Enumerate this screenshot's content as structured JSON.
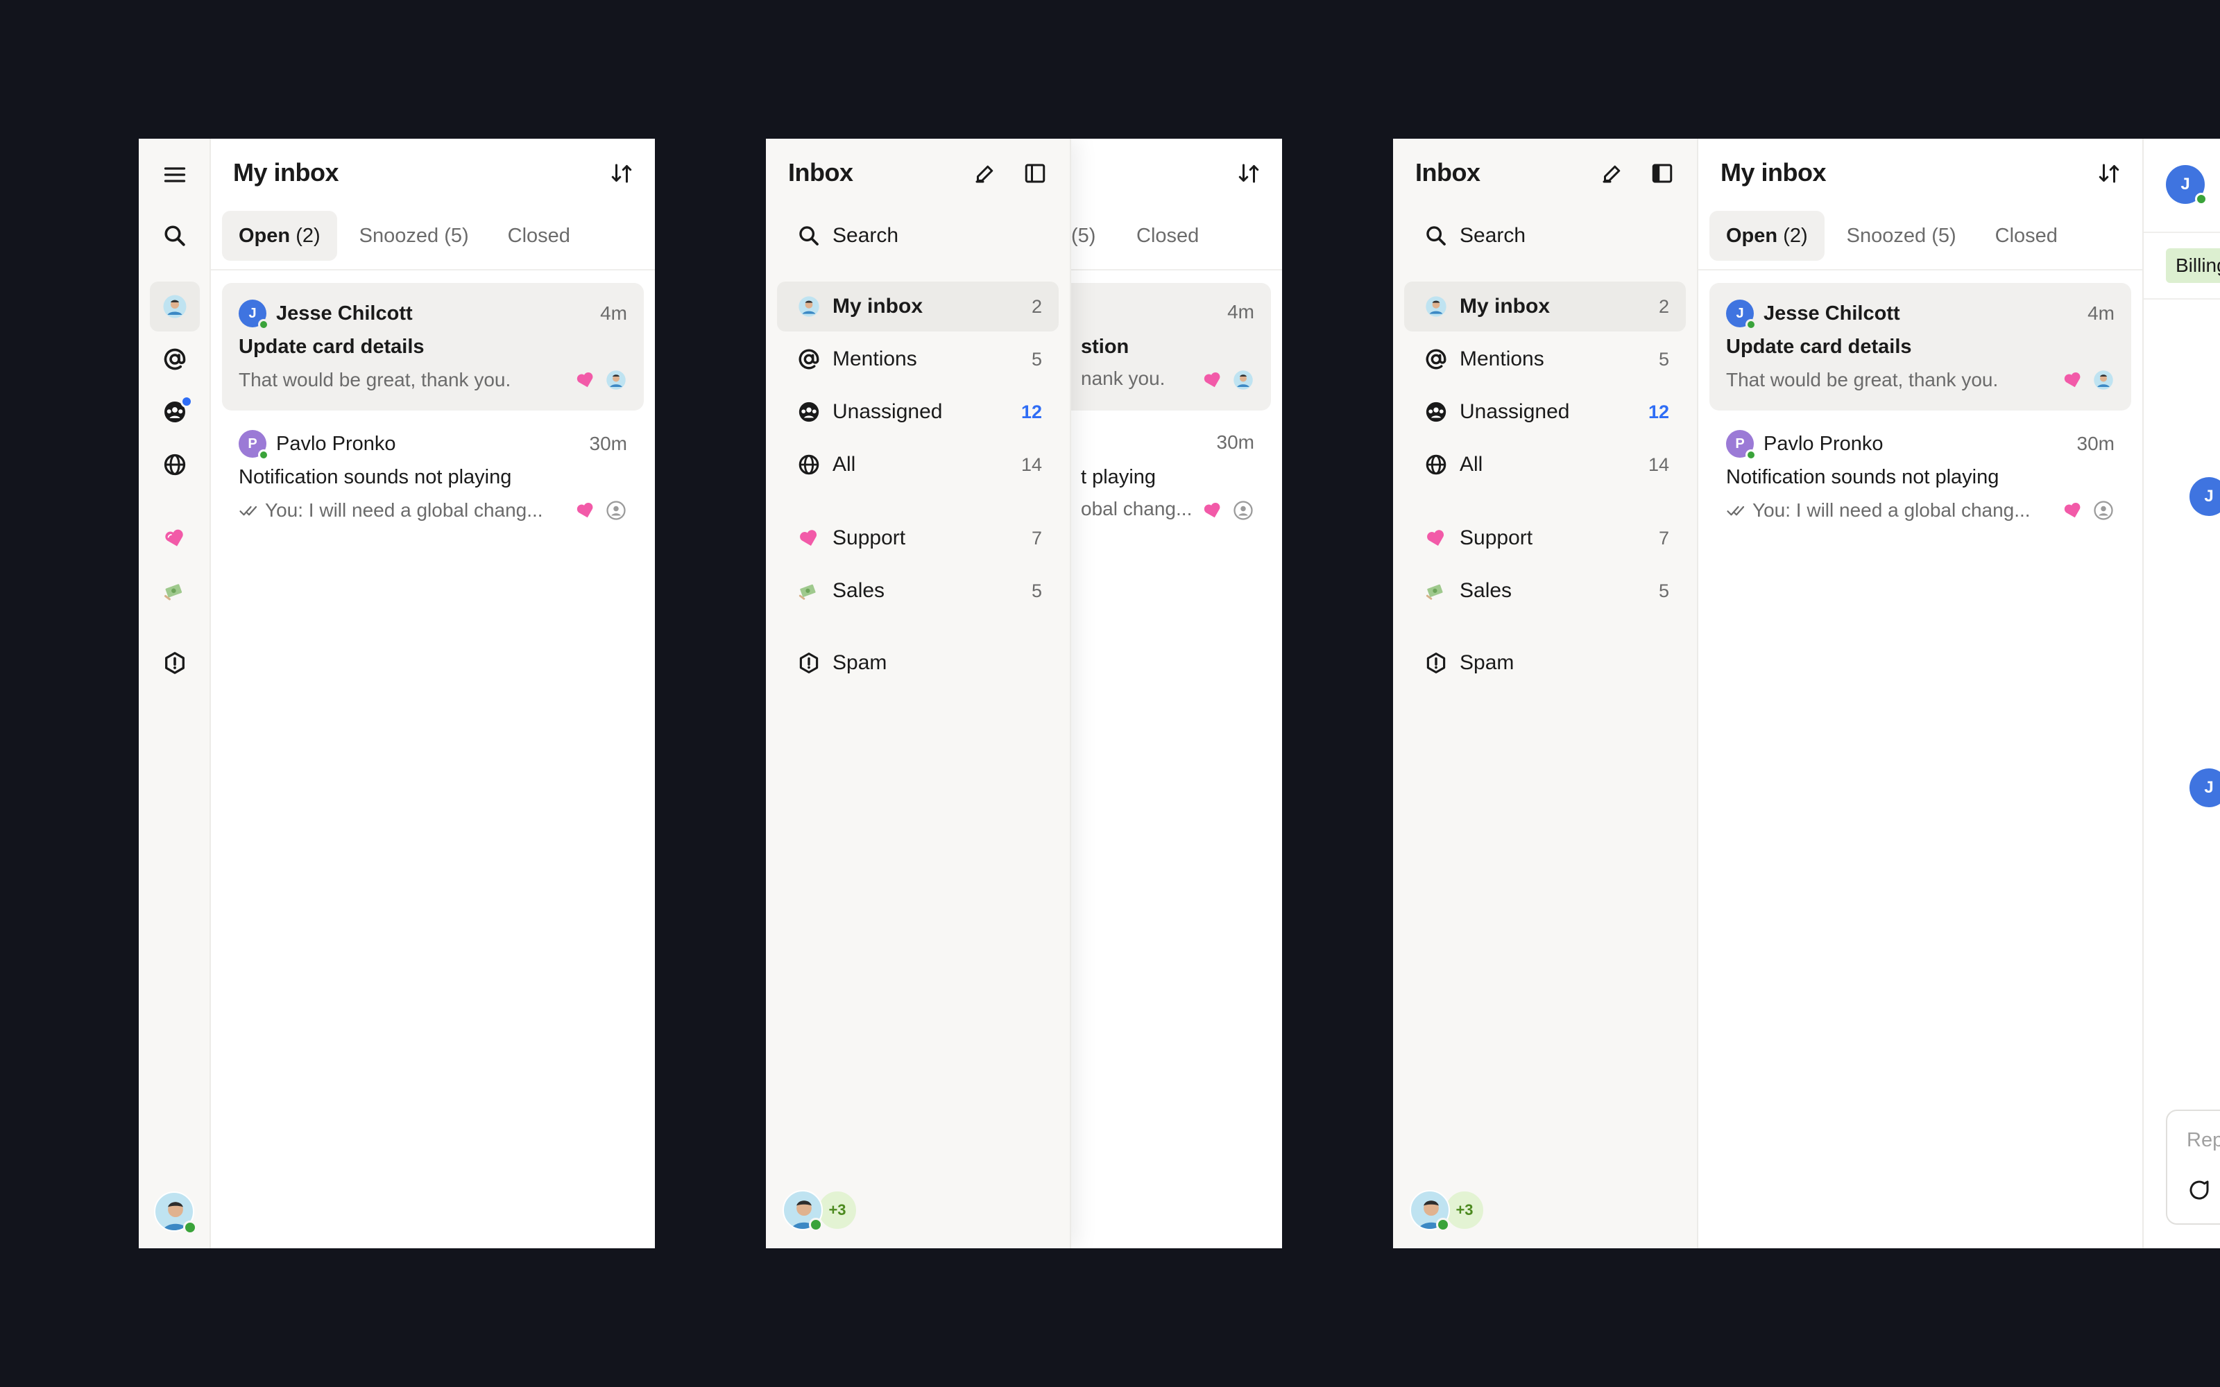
{
  "list": {
    "title": "My inbox",
    "tabs": [
      {
        "name": "Open",
        "count": "(2)"
      },
      {
        "name": "Snoozed",
        "count": "(5)"
      },
      {
        "name": "Closed",
        "count": ""
      }
    ],
    "conversations": [
      {
        "initial": "J",
        "name": "Jesse Chilcott",
        "time": "4m",
        "subject": "Update card details",
        "preview": "That would be great, thank you.",
        "avatar_color": "#3f74e0",
        "unread": true
      },
      {
        "initial": "P",
        "name": "Pavlo Pronko",
        "time": "30m",
        "subject": "Notification sounds not playing",
        "preview": "You: I will need a global chang...",
        "avatar_color": "#9b7ad6",
        "unread": false
      }
    ],
    "clipped": {
      "tab_snoozed": "(5)",
      "tab_closed": "Closed",
      "time1": "4m",
      "subject1": "stion",
      "preview1": "nank you.",
      "time2": "30m",
      "subject2": "t playing",
      "preview2": "obal chang..."
    }
  },
  "nav": {
    "title": "Inbox",
    "search_label": "Search",
    "items": [
      {
        "label": "My inbox",
        "count": "2"
      },
      {
        "label": "Mentions",
        "count": "5"
      },
      {
        "label": "Unassigned",
        "count": "12"
      },
      {
        "label": "All",
        "count": "14"
      },
      {
        "label": "Support",
        "count": "7"
      },
      {
        "label": "Sales",
        "count": "5"
      },
      {
        "label": "Spam",
        "count": ""
      }
    ],
    "extra_teammates": "+3"
  },
  "conversation": {
    "avatar_initial": "J",
    "tag": "Billing",
    "reply_placeholder": "Rep"
  },
  "colors": {
    "background": "#12141c",
    "accent_blue": "#2f6df5",
    "online_green": "#3aa33a",
    "tag_green": "#dcefd0",
    "selected_bg": "#f1f0ee"
  },
  "icons": {
    "menu": "hamburger-icon",
    "search": "search-icon",
    "mention": "at-sign-icon",
    "unassigned": "team-icon",
    "all": "globe-icon",
    "support": "heart-icon",
    "sales": "money-icon",
    "spam": "alert-icon",
    "compose": "pencil-icon",
    "sidebar_toggle": "sidebar-icon",
    "sort": "sort-icon"
  }
}
